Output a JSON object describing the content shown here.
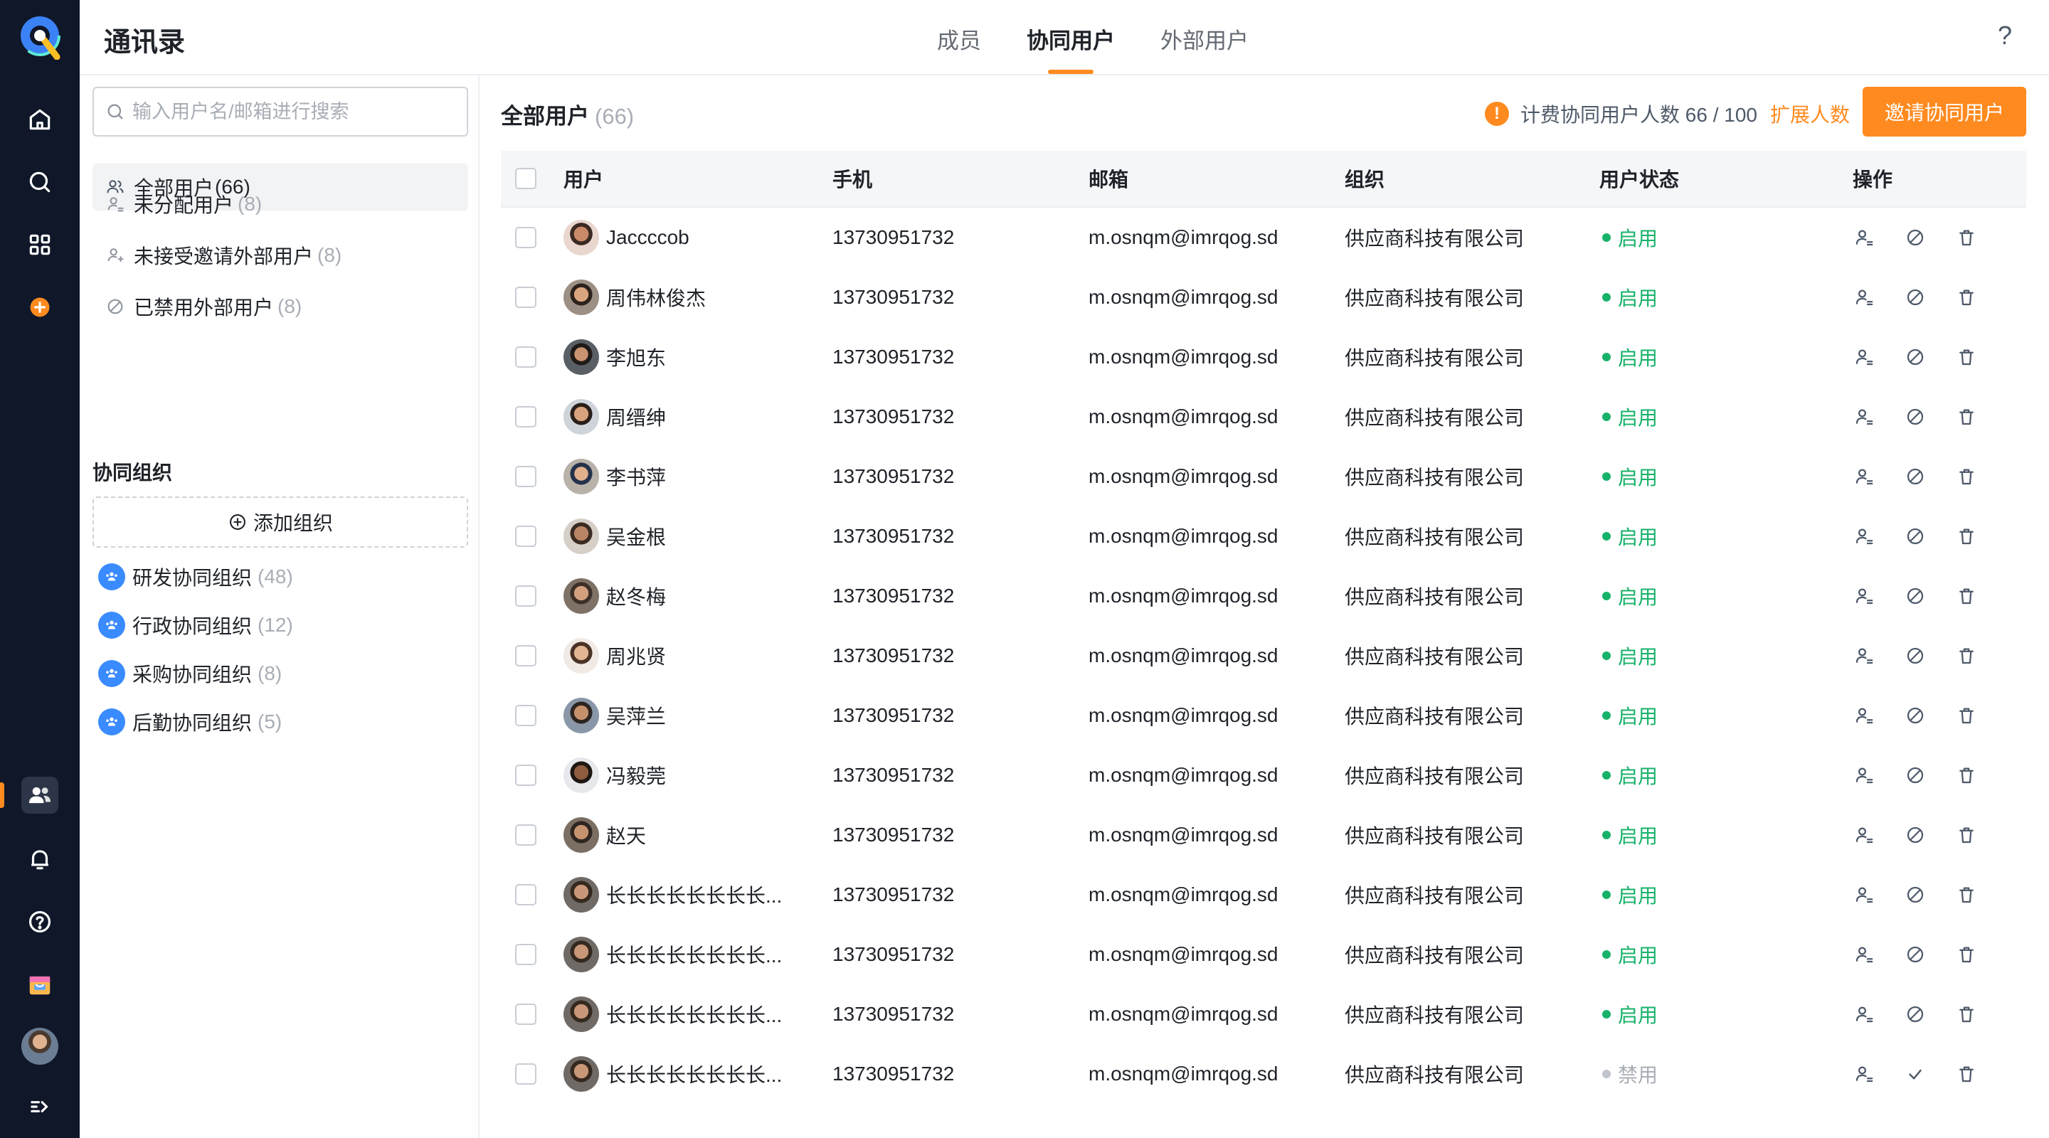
{
  "app": {
    "title": "通讯录"
  },
  "tabs": [
    {
      "label": "成员",
      "active": false
    },
    {
      "label": "协同用户",
      "active": true
    },
    {
      "label": "外部用户",
      "active": false
    }
  ],
  "help_label": "?",
  "sidebar": {
    "search_placeholder": "输入用户名/邮箱进行搜索",
    "nav": [
      {
        "label": "全部用户",
        "count": "(66)",
        "active": true,
        "icon": "users-icon"
      },
      {
        "label": "未分配用户",
        "count": "(8)",
        "active": false,
        "icon": "user-unassigned-icon"
      },
      {
        "label": "未接受邀请外部用户",
        "count": "(8)",
        "active": false,
        "icon": "user-pending-icon"
      },
      {
        "label": "已禁用外部用户",
        "count": "(8)",
        "active": false,
        "icon": "ban-icon"
      }
    ],
    "section_title": "协同组织",
    "add_org_label": "添加组织",
    "orgs": [
      {
        "label": "研发协同组织",
        "count": "(48)"
      },
      {
        "label": "行政协同组织",
        "count": "(12)"
      },
      {
        "label": "采购协同组织",
        "count": "(8)"
      },
      {
        "label": "后勤协同组织",
        "count": "(5)"
      }
    ]
  },
  "main": {
    "title": "全部用户",
    "count": "(66)",
    "quota_text": "计费协同用户人数 66 / 100",
    "expand_label": "扩展人数",
    "invite_label": "邀请协同用户",
    "columns": [
      "用户",
      "手机",
      "邮箱",
      "组织",
      "用户状态",
      "操作"
    ],
    "rows": [
      {
        "name": "Jaccccob",
        "phone": "13730951732",
        "email": "m.osnqm@imrqog.sd",
        "org": "供应商科技有限公司",
        "status": "启用",
        "enabled": true
      },
      {
        "name": "周伟林俊杰",
        "phone": "13730951732",
        "email": "m.osnqm@imrqog.sd",
        "org": "供应商科技有限公司",
        "status": "启用",
        "enabled": true
      },
      {
        "name": "李旭东",
        "phone": "13730951732",
        "email": "m.osnqm@imrqog.sd",
        "org": "供应商科技有限公司",
        "status": "启用",
        "enabled": true
      },
      {
        "name": "周缙绅",
        "phone": "13730951732",
        "email": "m.osnqm@imrqog.sd",
        "org": "供应商科技有限公司",
        "status": "启用",
        "enabled": true
      },
      {
        "name": "李书萍",
        "phone": "13730951732",
        "email": "m.osnqm@imrqog.sd",
        "org": "供应商科技有限公司",
        "status": "启用",
        "enabled": true
      },
      {
        "name": "吴金根",
        "phone": "13730951732",
        "email": "m.osnqm@imrqog.sd",
        "org": "供应商科技有限公司",
        "status": "启用",
        "enabled": true
      },
      {
        "name": "赵冬梅",
        "phone": "13730951732",
        "email": "m.osnqm@imrqog.sd",
        "org": "供应商科技有限公司",
        "status": "启用",
        "enabled": true
      },
      {
        "name": "周兆贤",
        "phone": "13730951732",
        "email": "m.osnqm@imrqog.sd",
        "org": "供应商科技有限公司",
        "status": "启用",
        "enabled": true
      },
      {
        "name": "吴萍兰",
        "phone": "13730951732",
        "email": "m.osnqm@imrqog.sd",
        "org": "供应商科技有限公司",
        "status": "启用",
        "enabled": true
      },
      {
        "name": "冯毅莞",
        "phone": "13730951732",
        "email": "m.osnqm@imrqog.sd",
        "org": "供应商科技有限公司",
        "status": "启用",
        "enabled": true
      },
      {
        "name": "赵天",
        "phone": "13730951732",
        "email": "m.osnqm@imrqog.sd",
        "org": "供应商科技有限公司",
        "status": "启用",
        "enabled": true
      },
      {
        "name": "长长长长长长长长...",
        "phone": "13730951732",
        "email": "m.osnqm@imrqog.sd",
        "org": "供应商科技有限公司",
        "status": "启用",
        "enabled": true
      },
      {
        "name": "长长长长长长长长...",
        "phone": "13730951732",
        "email": "m.osnqm@imrqog.sd",
        "org": "供应商科技有限公司",
        "status": "启用",
        "enabled": true
      },
      {
        "name": "长长长长长长长长...",
        "phone": "13730951732",
        "email": "m.osnqm@imrqog.sd",
        "org": "供应商科技有限公司",
        "status": "启用",
        "enabled": true
      },
      {
        "name": "长长长长长长长长...",
        "phone": "13730951732",
        "email": "m.osnqm@imrqog.sd",
        "org": "供应商科技有限公司",
        "status": "禁用",
        "enabled": false
      }
    ]
  },
  "colors": {
    "accent": "#ff8a1f",
    "rail": "#0f1729",
    "enabled": "#17b26a",
    "disabled": "#a8adb5",
    "org_badge": "#3a8bff"
  }
}
